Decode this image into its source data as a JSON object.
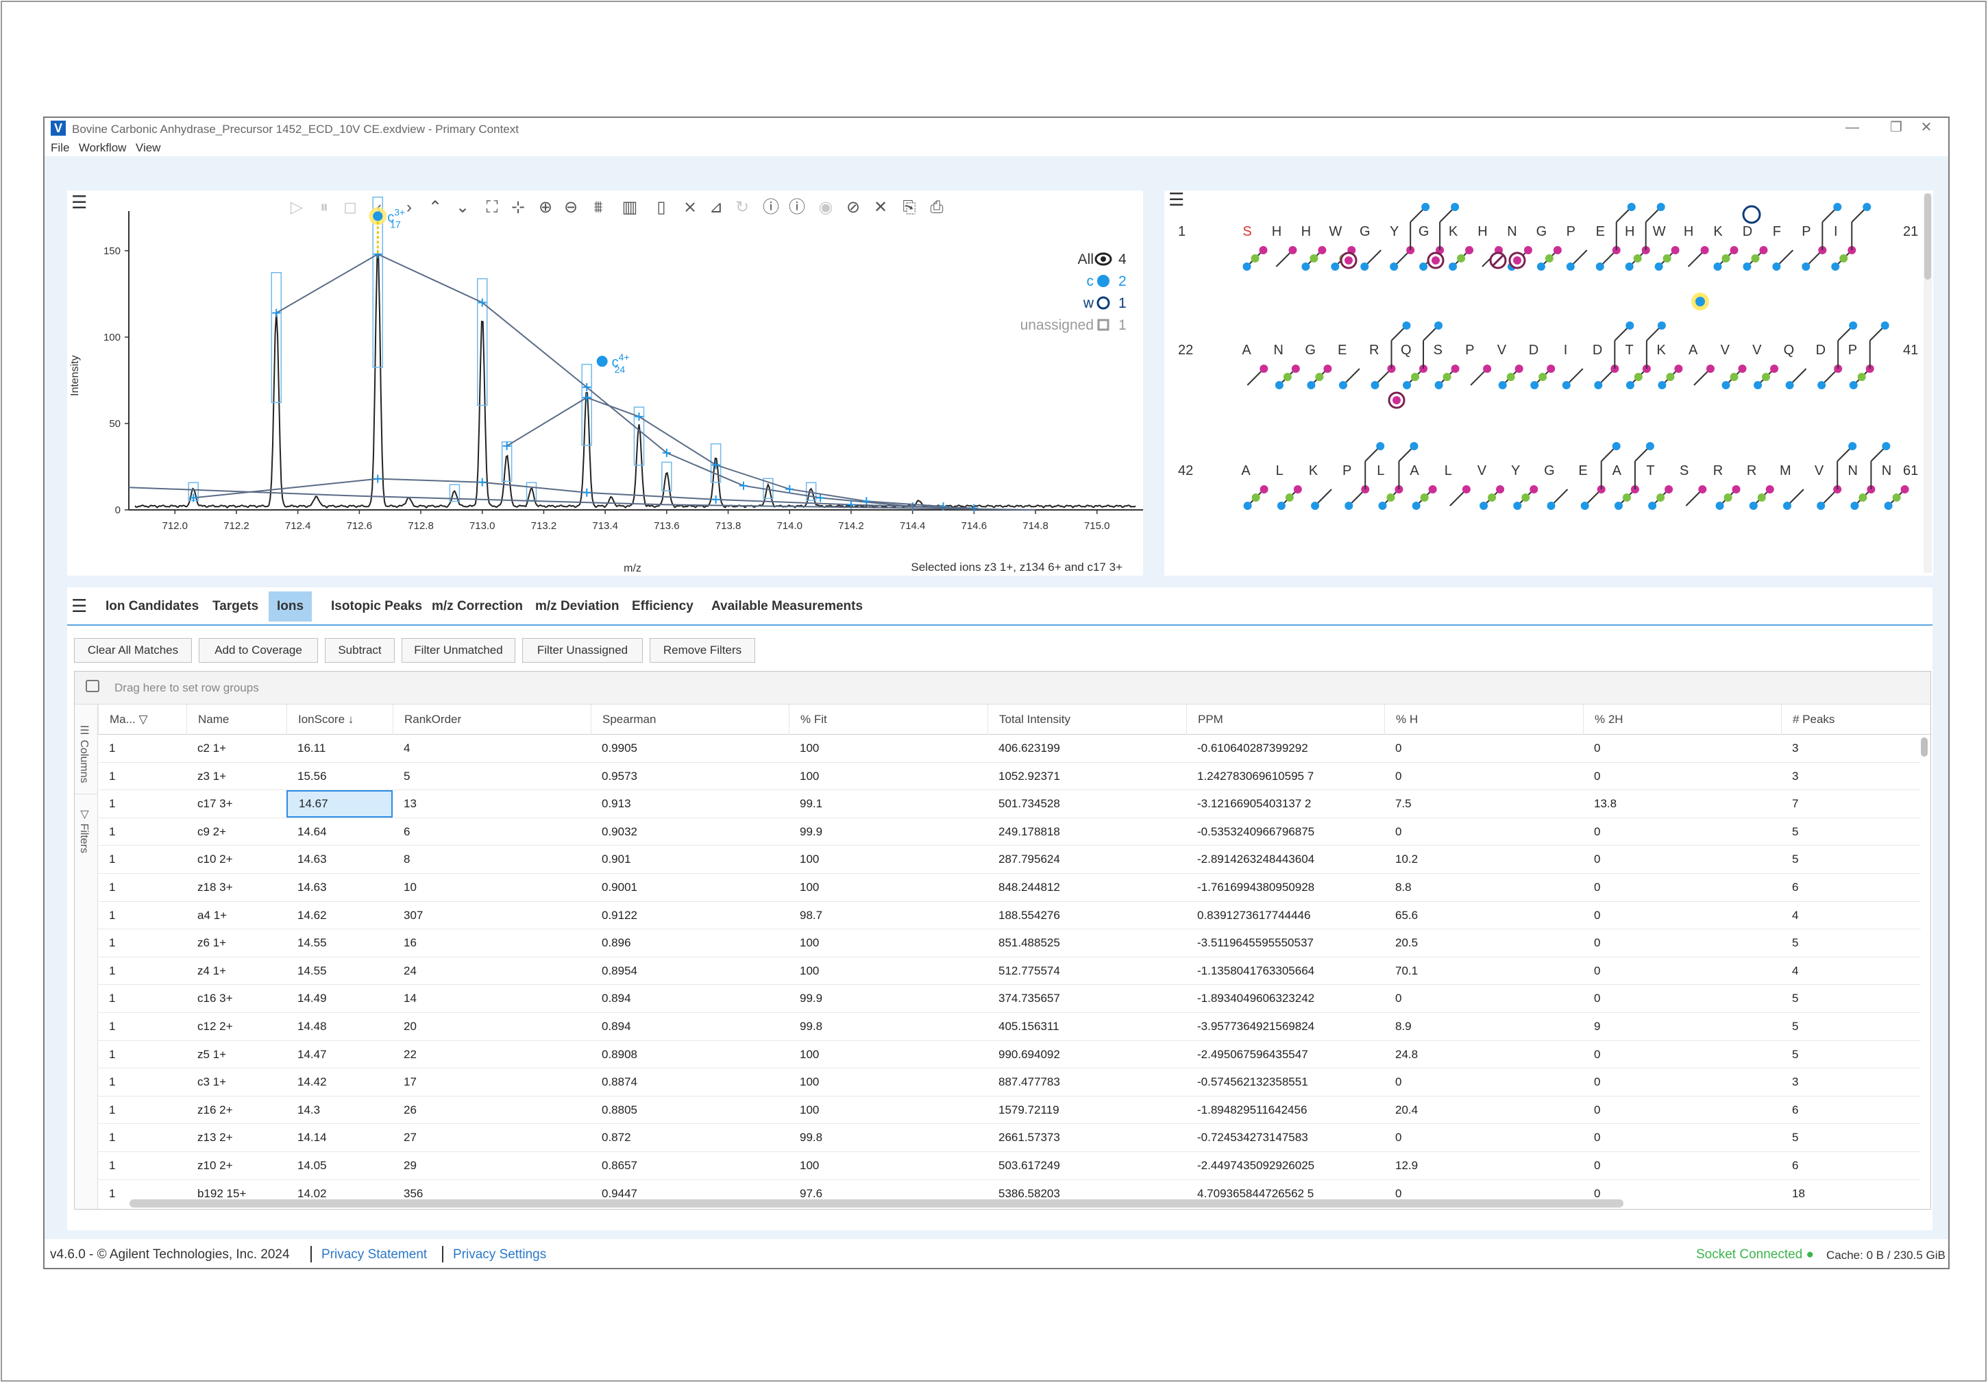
{
  "window": {
    "title": "Bovine Carbonic Anhydrase_Precursor 1452_ECD_10V CE.exdview - Primary Context",
    "logo_letter": "V",
    "minimize": "—",
    "restore": "❐",
    "close": "✕"
  },
  "menu": [
    "File",
    "Workflow",
    "View"
  ],
  "colors": {
    "accent": "#59a5e0",
    "c_ion": "#1e97e6",
    "w_ion": "#0c3c78",
    "pink": "#cc2e96",
    "green": "#7cc142",
    "status_green": "#3cb44a",
    "link": "#2a78c8"
  },
  "spectrum": {
    "y_label": "Intensity",
    "x_label": "m/z",
    "y_ticks": [
      "150",
      "100",
      "50",
      "0"
    ],
    "x_ticks": [
      "712.0",
      "712.2",
      "712.4",
      "712.6",
      "712.8",
      "713.0",
      "713.2",
      "713.4",
      "713.6",
      "713.8",
      "714.0",
      "714.2",
      "714.4",
      "714.6",
      "714.8",
      "715.0"
    ],
    "legend": {
      "all_label": "All",
      "all_count": "4",
      "c_label": "c",
      "c_count": "2",
      "w_label": "w",
      "w_count": "1",
      "unassigned_label": "unassigned",
      "unassigned_count": "1"
    },
    "annotations": [
      {
        "ion": "c",
        "sup": "3+",
        "sub": "17"
      },
      {
        "ion": "c",
        "sup": "4+",
        "sub": "24"
      }
    ],
    "selection_text": "Selected ions z3 1+, z134 6+ and c17 3+",
    "toolbar_icons": [
      "play-icon",
      "pause-icon",
      "stop-icon",
      "prev-icon",
      "next-icon",
      "expand-up-icon",
      "expand-down-icon",
      "fit-icon",
      "shrink-icon",
      "zoom-in-icon",
      "zoom-out-icon",
      "peaks-icon",
      "bar-chart-icon",
      "ruler-icon",
      "chart-clear-icon",
      "chart-line-icon",
      "redo-icon",
      "info-icon",
      "info-clear-icon",
      "eye-icon",
      "eye-off-icon",
      "close-x-icon",
      "export-icon",
      "export-image-icon"
    ],
    "chart_data": {
      "type": "line",
      "xlabel": "m/z",
      "ylabel": "Intensity",
      "xlim": [
        711.85,
        715.15
      ],
      "ylim": [
        0,
        165
      ],
      "peaks": [
        {
          "x": 712.06,
          "y": 10
        },
        {
          "x": 712.33,
          "y": 113
        },
        {
          "x": 712.46,
          "y": 6
        },
        {
          "x": 712.66,
          "y": 150
        },
        {
          "x": 712.76,
          "y": 5
        },
        {
          "x": 712.91,
          "y": 9
        },
        {
          "x": 713.0,
          "y": 110
        },
        {
          "x": 713.08,
          "y": 30
        },
        {
          "x": 713.16,
          "y": 10
        },
        {
          "x": 713.34,
          "y": 68
        },
        {
          "x": 713.42,
          "y": 5
        },
        {
          "x": 713.51,
          "y": 47
        },
        {
          "x": 713.6,
          "y": 20
        },
        {
          "x": 713.76,
          "y": 29
        },
        {
          "x": 713.93,
          "y": 12
        },
        {
          "x": 714.07,
          "y": 10
        },
        {
          "x": 714.42,
          "y": 3
        }
      ],
      "theoretical_series": [
        {
          "name": "c17 3+",
          "points": [
            [
              712.33,
              114
            ],
            [
              712.66,
              148
            ],
            [
              713.0,
              120
            ],
            [
              713.34,
              71
            ],
            [
              713.6,
              33
            ],
            [
              713.85,
              14
            ],
            [
              714.1,
              7
            ],
            [
              714.4,
              2
            ]
          ]
        },
        {
          "name": "c24 4+",
          "points": [
            [
              713.08,
              37
            ],
            [
              713.34,
              65
            ],
            [
              713.51,
              54
            ],
            [
              713.76,
              26
            ],
            [
              714.0,
              12
            ],
            [
              714.25,
              5
            ],
            [
              714.5,
              2
            ]
          ]
        },
        {
          "name": "w",
          "points": [
            [
              712.06,
              7
            ],
            [
              712.66,
              18
            ],
            [
              713.0,
              16
            ],
            [
              713.34,
              10
            ],
            [
              713.76,
              6
            ],
            [
              714.2,
              3
            ],
            [
              714.6,
              1
            ]
          ]
        },
        {
          "name": "baseline",
          "points": [
            [
              711.85,
              13
            ],
            [
              712.6,
              8
            ],
            [
              713.6,
              3
            ],
            [
              714.8,
              0
            ]
          ]
        }
      ],
      "highlight_points": [
        {
          "x": 712.66,
          "y": 170
        },
        {
          "x": 713.39,
          "y": 86
        }
      ]
    }
  },
  "sequence": {
    "rows": [
      {
        "start": "1",
        "end": "21",
        "residues": [
          "S",
          "H",
          "H",
          "W",
          "G",
          "Y",
          "G",
          "K",
          "H",
          "N",
          "G",
          "P",
          "E",
          "H",
          "W",
          "H",
          "K",
          "D",
          "F",
          "P",
          "I"
        ]
      },
      {
        "start": "22",
        "end": "41",
        "residues": [
          "A",
          "N",
          "G",
          "E",
          "R",
          "Q",
          "S",
          "P",
          "V",
          "D",
          "I",
          "D",
          "T",
          "K",
          "A",
          "V",
          "V",
          "Q",
          "D",
          "P"
        ]
      },
      {
        "start": "42",
        "end": "61",
        "residues": [
          "A",
          "L",
          "K",
          "P",
          "L",
          "A",
          "L",
          "V",
          "Y",
          "G",
          "E",
          "A",
          "T",
          "S",
          "R",
          "R",
          "M",
          "V",
          "N",
          "N"
        ]
      }
    ]
  },
  "tabs": [
    "Ion Candidates",
    "Targets",
    "Ions",
    "Isotopic Peaks",
    "m/z Correction",
    "m/z Deviation",
    "Efficiency",
    "Available Measurements"
  ],
  "active_tab": "Ions",
  "actions": [
    "Clear All Matches",
    "Add to Coverage",
    "Subtract",
    "Filter Unmatched",
    "Filter Unassigned",
    "Remove Filters"
  ],
  "grid": {
    "group_placeholder": "Drag here to set row groups",
    "side_columns": "Columns",
    "side_filters": "Filters",
    "columns": [
      "Ma...",
      "Name",
      "IonScore",
      "RankOrder",
      "Spearman",
      "% Fit",
      "Total Intensity",
      "PPM",
      "% H",
      "% 2H",
      "# Peaks"
    ],
    "rows": [
      [
        "1",
        "c2 1+",
        "16.11",
        "4",
        "0.9905",
        "100",
        "406.623199",
        "-0.610640287399292",
        "0",
        "0",
        "3"
      ],
      [
        "1",
        "z3 1+",
        "15.56",
        "5",
        "0.9573",
        "100",
        "1052.92371",
        "1.242783069610595 7",
        "0",
        "0",
        "3"
      ],
      [
        "1",
        "c17 3+",
        "14.67",
        "13",
        "0.913",
        "99.1",
        "501.734528",
        "-3.12166905403137 2",
        "7.5",
        "13.8",
        "7"
      ],
      [
        "1",
        "c9 2+",
        "14.64",
        "6",
        "0.9032",
        "99.9",
        "249.178818",
        "-0.5353240966796875",
        "0",
        "0",
        "5"
      ],
      [
        "1",
        "c10 2+",
        "14.63",
        "8",
        "0.901",
        "100",
        "287.795624",
        "-2.8914263248443604",
        "10.2",
        "0",
        "5"
      ],
      [
        "1",
        "z18 3+",
        "14.63",
        "10",
        "0.9001",
        "100",
        "848.244812",
        "-1.7616994380950928",
        "8.8",
        "0",
        "6"
      ],
      [
        "1",
        "a4 1+",
        "14.62",
        "307",
        "0.9122",
        "98.7",
        "188.554276",
        "0.8391273617744446",
        "65.6",
        "0",
        "4"
      ],
      [
        "1",
        "z6 1+",
        "14.55",
        "16",
        "0.896",
        "100",
        "851.488525",
        "-3.5119645595550537",
        "20.5",
        "0",
        "5"
      ],
      [
        "1",
        "z4 1+",
        "14.55",
        "24",
        "0.8954",
        "100",
        "512.775574",
        "-1.1358041763305664",
        "70.1",
        "0",
        "4"
      ],
      [
        "1",
        "c16 3+",
        "14.49",
        "14",
        "0.894",
        "99.9",
        "374.735657",
        "-1.8934049606323242",
        "0",
        "0",
        "5"
      ],
      [
        "1",
        "c12 2+",
        "14.48",
        "20",
        "0.894",
        "99.8",
        "405.156311",
        "-3.9577364921569824",
        "8.9",
        "9",
        "5"
      ],
      [
        "1",
        "z5 1+",
        "14.47",
        "22",
        "0.8908",
        "100",
        "990.694092",
        "-2.495067596435547",
        "24.8",
        "0",
        "5"
      ],
      [
        "1",
        "c3 1+",
        "14.42",
        "17",
        "0.8874",
        "100",
        "887.477783",
        "-0.574562132358551",
        "0",
        "0",
        "3"
      ],
      [
        "1",
        "z16 2+",
        "14.3",
        "26",
        "0.8805",
        "100",
        "1579.72119",
        "-1.894829511642456",
        "20.4",
        "0",
        "6"
      ],
      [
        "1",
        "z13 2+",
        "14.14",
        "27",
        "0.872",
        "99.8",
        "2661.57373",
        "-0.724534273147583",
        "0",
        "0",
        "5"
      ],
      [
        "1",
        "z10 2+",
        "14.05",
        "29",
        "0.8657",
        "100",
        "503.617249",
        "-2.4497435092926025",
        "12.9",
        "0",
        "6"
      ],
      [
        "1",
        "b192 15+",
        "14.02",
        "356",
        "0.9447",
        "97.6",
        "5386.58203",
        "4.709365844726562 5",
        "0",
        "0",
        "18"
      ]
    ]
  },
  "footer": {
    "version": "v4.6.0 - © Agilent Technologies, Inc. 2024",
    "privacy_statement": "Privacy Statement",
    "privacy_settings": "Privacy Settings",
    "socket_status": "Socket Connected ●",
    "cache": "Cache: 0 B / 230.5 GiB"
  }
}
